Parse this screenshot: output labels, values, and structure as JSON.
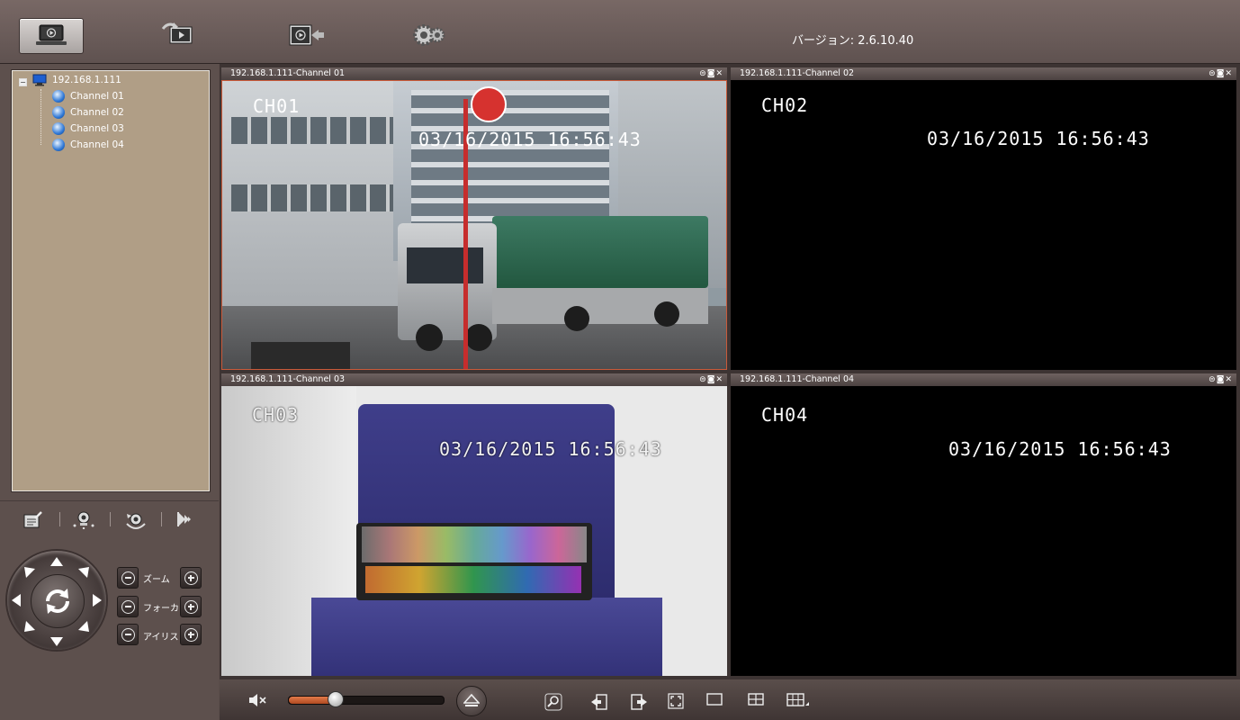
{
  "app": {
    "version_text": "バージョン: 2.6.10.40"
  },
  "toolbar": {
    "buttons": [
      {
        "icon": "live-view-icon"
      },
      {
        "icon": "playback-icon"
      },
      {
        "icon": "remote-playback-icon"
      },
      {
        "icon": "settings-gears-icon"
      }
    ]
  },
  "tree": {
    "device": "192.168.1.111",
    "channels": [
      "Channel 01",
      "Channel 02",
      "Channel 03",
      "Channel 04"
    ]
  },
  "ptz": {
    "zoom_label": "ズーム",
    "focus_label": "フォーカ",
    "iris_label": "アイリス"
  },
  "views": [
    {
      "title": "192.168.1.111-Channel 01",
      "osd_channel": "CH01",
      "osd_time": "03/16/2015 16:56:43"
    },
    {
      "title": "192.168.1.111-Channel 02",
      "osd_channel": "CH02",
      "osd_time": "03/16/2015 16:56:43"
    },
    {
      "title": "192.168.1.111-Channel 03",
      "osd_channel": "CH03",
      "osd_time": "03/16/2015 16:56:43"
    },
    {
      "title": "192.168.1.111-Channel 04",
      "osd_channel": "CH04",
      "osd_time": "03/16/2015 16:56:43"
    }
  ],
  "volume": {
    "level": 0.3
  },
  "colors": {
    "accent": "#c95a3a",
    "panel": "#b09e86"
  }
}
